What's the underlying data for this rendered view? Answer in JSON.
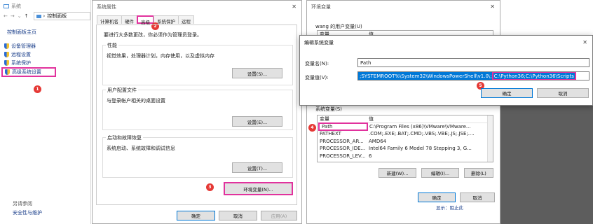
{
  "control_panel": {
    "title": "系统",
    "address": "控制面板",
    "home": "控制面板主页",
    "items": [
      {
        "label": "设备管理器"
      },
      {
        "label": "远程设置"
      },
      {
        "label": "系统保护"
      },
      {
        "label": "高级系统设置"
      }
    ],
    "see_also": "另请参阅",
    "security": "安全性与维护",
    "annotation_1": "1"
  },
  "system_props": {
    "title": "系统属性",
    "tabs": [
      "计算机名",
      "硬件",
      "高级",
      "系统保护",
      "远程"
    ],
    "admin_note": "要进行大多数更改，你必须作为管理员登录。",
    "performance": {
      "title": "性能",
      "desc": "视觉效果，处理器计划，内存使用，以及虚拟内存",
      "button": "设置(S)..."
    },
    "user_profiles": {
      "title": "用户配置文件",
      "desc": "与登录帐户相关的桌面设置",
      "button": "设置(E)..."
    },
    "startup": {
      "title": "启动和故障恢复",
      "desc": "系统启动、系统故障和调试信息",
      "button": "设置(T)..."
    },
    "env_button": "环境变量(N)...",
    "ok": "确定",
    "cancel": "取消",
    "apply": "应用(A)",
    "annotation_2": "2",
    "annotation_3": "3"
  },
  "env_vars": {
    "title": "环境变量",
    "user_section": "wang 的用户变量(U)",
    "user_header": {
      "var": "变量",
      "val": "值"
    },
    "system_section": "系统变量(S)",
    "system_header": {
      "var": "变量",
      "val": "值"
    },
    "system_rows": [
      {
        "var": "Path",
        "val": "C:\\Program Files (x86)\\VMware\\VMware..."
      },
      {
        "var": "PATHEXT",
        "val": ".COM;.EXE;.BAT;.CMD;.VBS;.VBE;.JS;.JSE;...."
      },
      {
        "var": "PROCESSOR_AR...",
        "val": "AMD64"
      },
      {
        "var": "PROCESSOR_IDE...",
        "val": "Intel64 Family 6 Model 78 Stepping 3, G..."
      },
      {
        "var": "PROCESSOR_LEV...",
        "val": "6"
      }
    ],
    "new": "新建(W)...",
    "edit": "编辑(I)...",
    "delete": "删除(L)",
    "ok": "确定",
    "cancel": "取消",
    "annotation_4": "4",
    "bottom_link": "显示：阻止此"
  },
  "edit_dialog": {
    "title": "编辑系统变量",
    "name_label": "变量名(N):",
    "name_value": "Path",
    "value_label": "变量值(V):",
    "value_text": ";SYSTEMROOT%\\System32\\WindowsPowerShell\\v1.0\\;",
    "value_added": "C:\\Python36;C:\\Python36\\Scripts",
    "ok": "确定",
    "cancel": "取消",
    "annotation_5": "5"
  },
  "colors": {
    "highlight": "#e1329d",
    "selection": "#0078d7",
    "annotation": "#e53935"
  }
}
